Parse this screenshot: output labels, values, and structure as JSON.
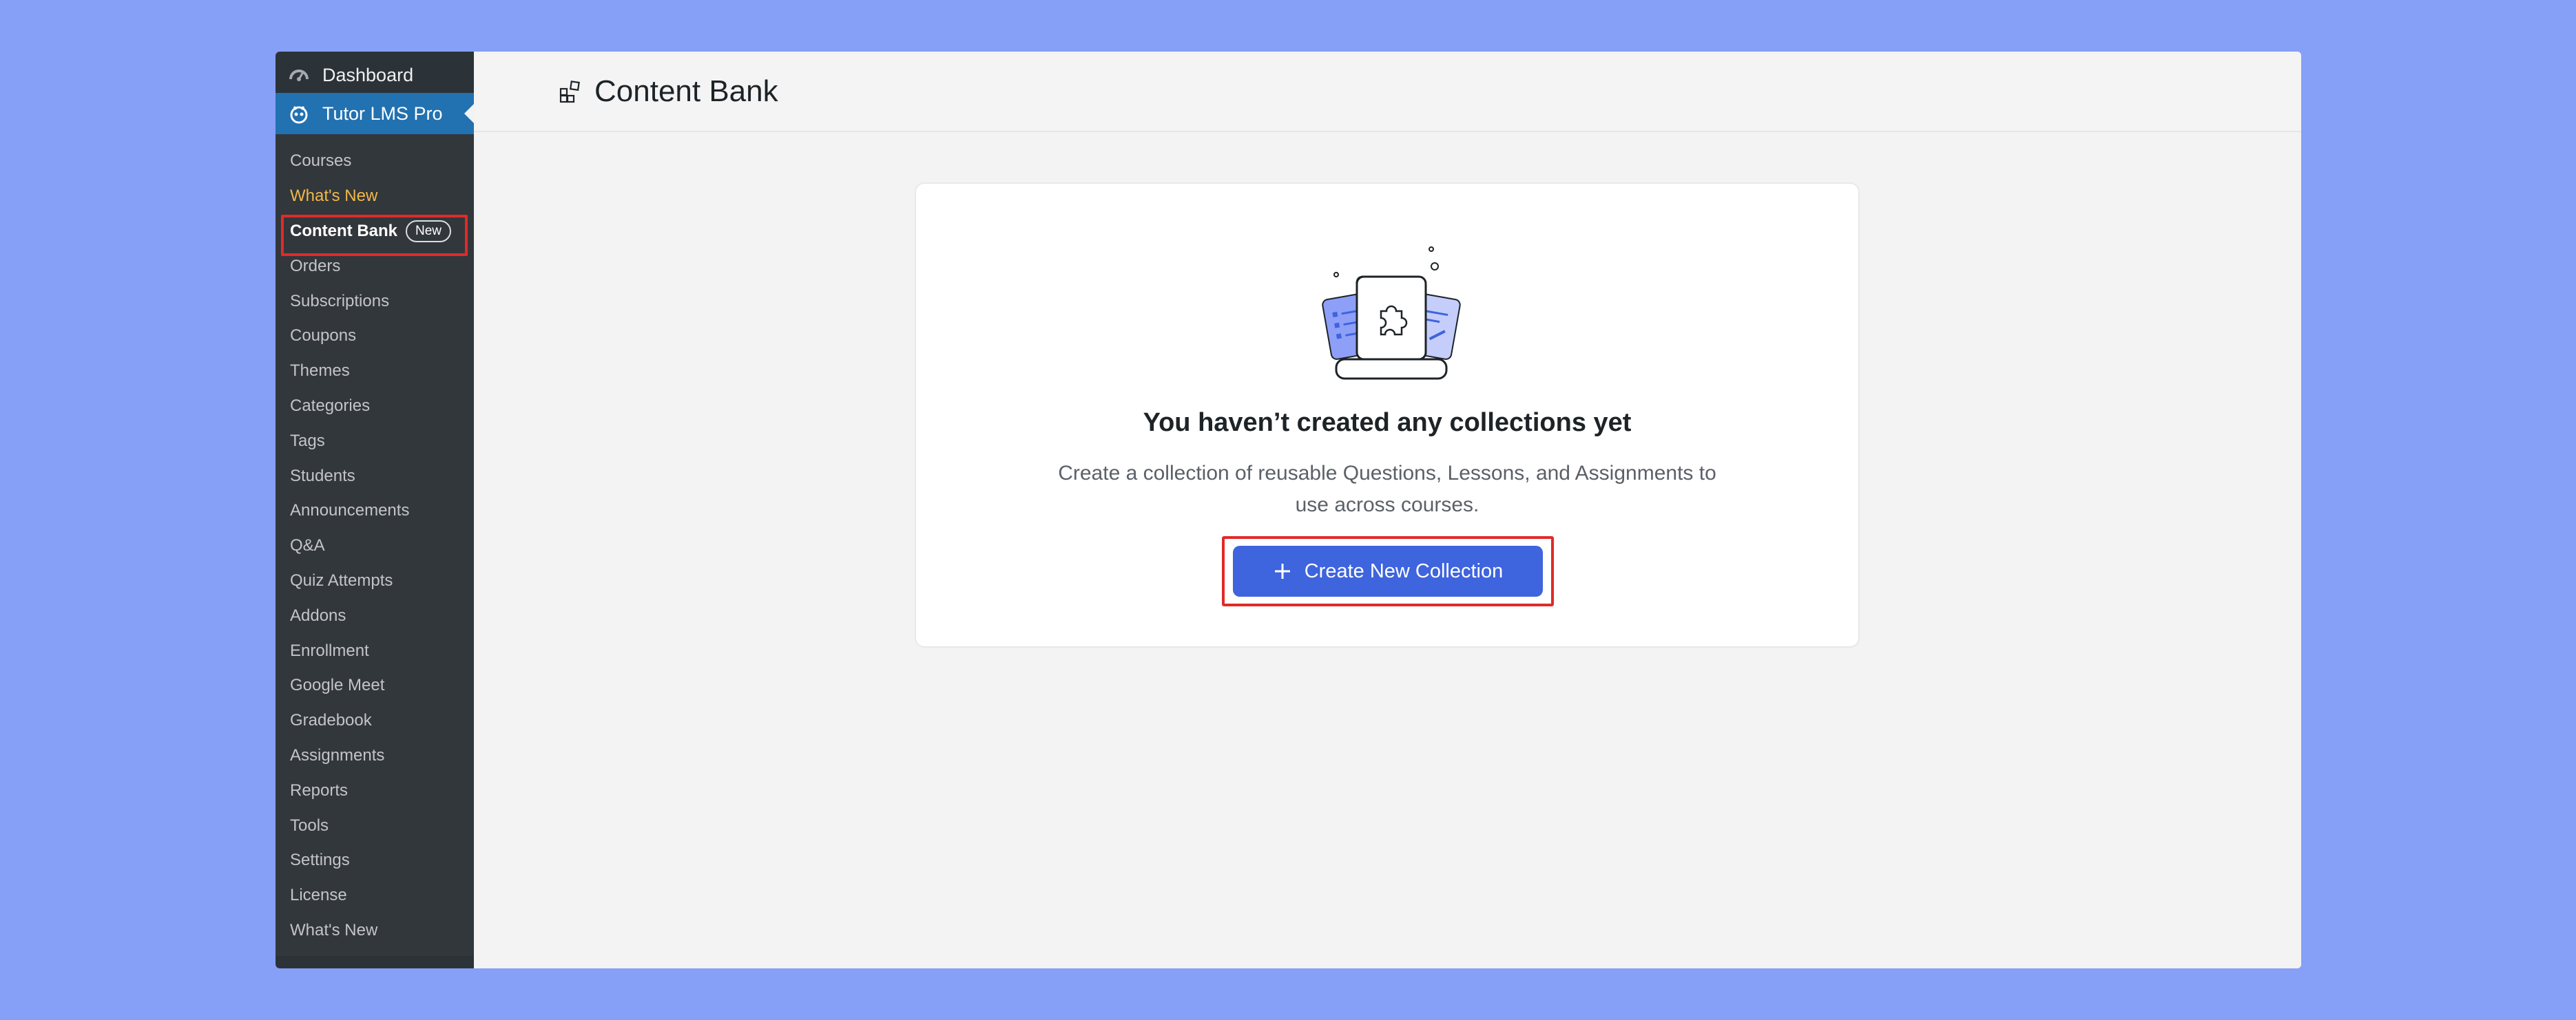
{
  "sidebar": {
    "dashboard_label": "Dashboard",
    "plugin_label": "Tutor LMS Pro",
    "items": [
      {
        "label": "Courses"
      },
      {
        "label": "What's New"
      },
      {
        "label": "Content Bank",
        "badge": "New"
      },
      {
        "label": "Orders"
      },
      {
        "label": "Subscriptions"
      },
      {
        "label": "Coupons"
      },
      {
        "label": "Themes"
      },
      {
        "label": "Categories"
      },
      {
        "label": "Tags"
      },
      {
        "label": "Students"
      },
      {
        "label": "Announcements"
      },
      {
        "label": "Q&A"
      },
      {
        "label": "Quiz Attempts"
      },
      {
        "label": "Addons"
      },
      {
        "label": "Enrollment"
      },
      {
        "label": "Google Meet"
      },
      {
        "label": "Gradebook"
      },
      {
        "label": "Assignments"
      },
      {
        "label": "Reports"
      },
      {
        "label": "Tools"
      },
      {
        "label": "Settings"
      },
      {
        "label": "License"
      },
      {
        "label": "What's New"
      }
    ]
  },
  "header": {
    "title": "Content Bank",
    "icon": "content-bank-icon"
  },
  "empty_state": {
    "title": "You haven’t created any collections yet",
    "description": "Create a collection of reusable Questions, Lessons, and Assignments to use across courses.",
    "button_label": "Create New Collection"
  },
  "colors": {
    "accent": "#3e64de",
    "sidebar_bg": "#2c3338",
    "active_menu": "#2271b1",
    "highlight": "#e02b27",
    "background": "#86a0f7"
  }
}
